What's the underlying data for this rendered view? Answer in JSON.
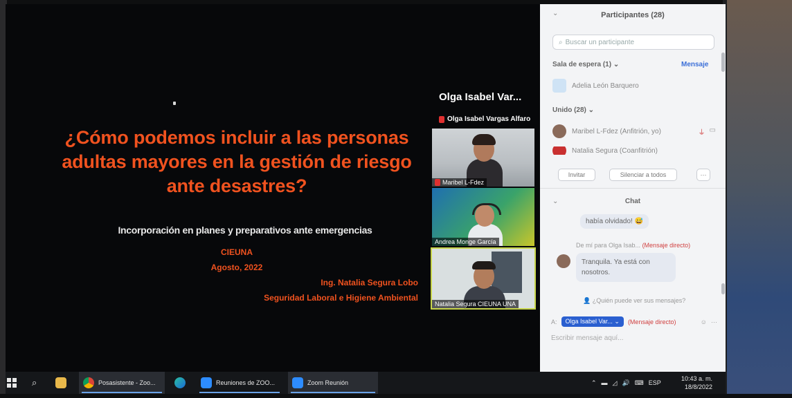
{
  "slide": {
    "title": "¿Cómo podemos incluir a las personas adultas mayores en la gestión de riesgo ante desastres?",
    "subtitle": "Incorporación en planes y preparativos ante emergencias",
    "org": "CIEUNA",
    "date": "Agosto, 2022",
    "author": "Ing. Natalia Segura Lobo",
    "department": "Seguridad Laboral e Higiene Ambiental"
  },
  "video_strip": {
    "speaker_title": "Olga Isabel Var...",
    "speaker_full_name": "Olga Isabel Vargas Alfaro",
    "tiles": [
      {
        "name": "Maribel L-Fdez"
      },
      {
        "name": "Andrea Monge García"
      },
      {
        "name": "Natalia Segura CIEUNA UNA"
      }
    ]
  },
  "participants": {
    "title": "Participantes (28)",
    "search_placeholder": "Buscar un participante",
    "waiting_room_label": "Sala de espera (1)",
    "admit_label": "Mensaje",
    "waiting": [
      {
        "name": "Adelia León Barquero"
      }
    ],
    "joined_label": "Unido (28)",
    "joined": [
      {
        "name": "Maribel L-Fdez (Anfitrión, yo)"
      },
      {
        "name": "Natalia Segura (Coanfitrión)"
      }
    ],
    "invite_label": "Invitar",
    "mute_all_label": "Silenciar a todos",
    "more_label": "···"
  },
  "chat": {
    "title": "Chat",
    "message1": "había olvidado!",
    "meta_from": "De mí para Olga Isab...",
    "meta_direct": "(Mensaje directo)",
    "message2": "Tranquila. Ya está con nosotros.",
    "who_can_see": "¿Quién puede ver sus mensajes?",
    "to_label": "A:",
    "to_pill": "Olga Isabel Var...",
    "to_direct": "(Mensaje directo)",
    "compose_placeholder": "Escribir mensaje aquí..."
  },
  "taskbar": {
    "chrome_label": "Posasistente - Zoo...",
    "zoom_meetings_label": "Reuniones de ZOO...",
    "zoom_meeting_label": "Zoom Reunión",
    "lang": "ESP",
    "time": "10:43 a. m.",
    "date": "18/8/2022"
  },
  "colors": {
    "slide_accent": "#f0521f",
    "zoom_blue": "#2a5fd0",
    "panel_bg": "#f3f4f6"
  }
}
